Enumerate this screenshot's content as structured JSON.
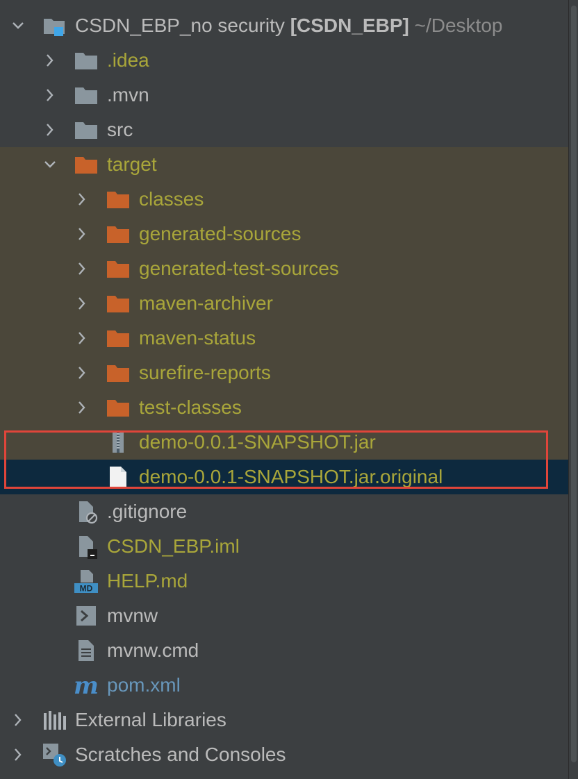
{
  "project": {
    "name": "CSDN_EBP_no security",
    "module": "[CSDN_EBP]",
    "path": "~/Desktop"
  },
  "items": {
    "idea": ".idea",
    "mvn": ".mvn",
    "src": "src",
    "target": "target",
    "classes": "classes",
    "generated_sources": "generated-sources",
    "generated_test_sources": "generated-test-sources",
    "maven_archiver": "maven-archiver",
    "maven_status": "maven-status",
    "surefire_reports": "surefire-reports",
    "test_classes": "test-classes",
    "jar": "demo-0.0.1-SNAPSHOT.jar",
    "jar_original": "demo-0.0.1-SNAPSHOT.jar.original",
    "gitignore": ".gitignore",
    "iml": "CSDN_EBP.iml",
    "help": "HELP.md",
    "mvnw": "mvnw",
    "mvnw_cmd": "mvnw.cmd",
    "pom": "pom.xml"
  },
  "roots": {
    "external_libraries": "External Libraries",
    "scratches": "Scratches and Consoles"
  },
  "icons": {
    "md_badge": "MD",
    "maven_m": "m"
  },
  "colors": {
    "background": "#3c3f41",
    "excluded_bg": "#4b473a",
    "selected_bg": "#0d293e",
    "excluded_folder": "#c8622a",
    "olive_text": "#a9a63a",
    "highlight_box": "#e0453a"
  }
}
